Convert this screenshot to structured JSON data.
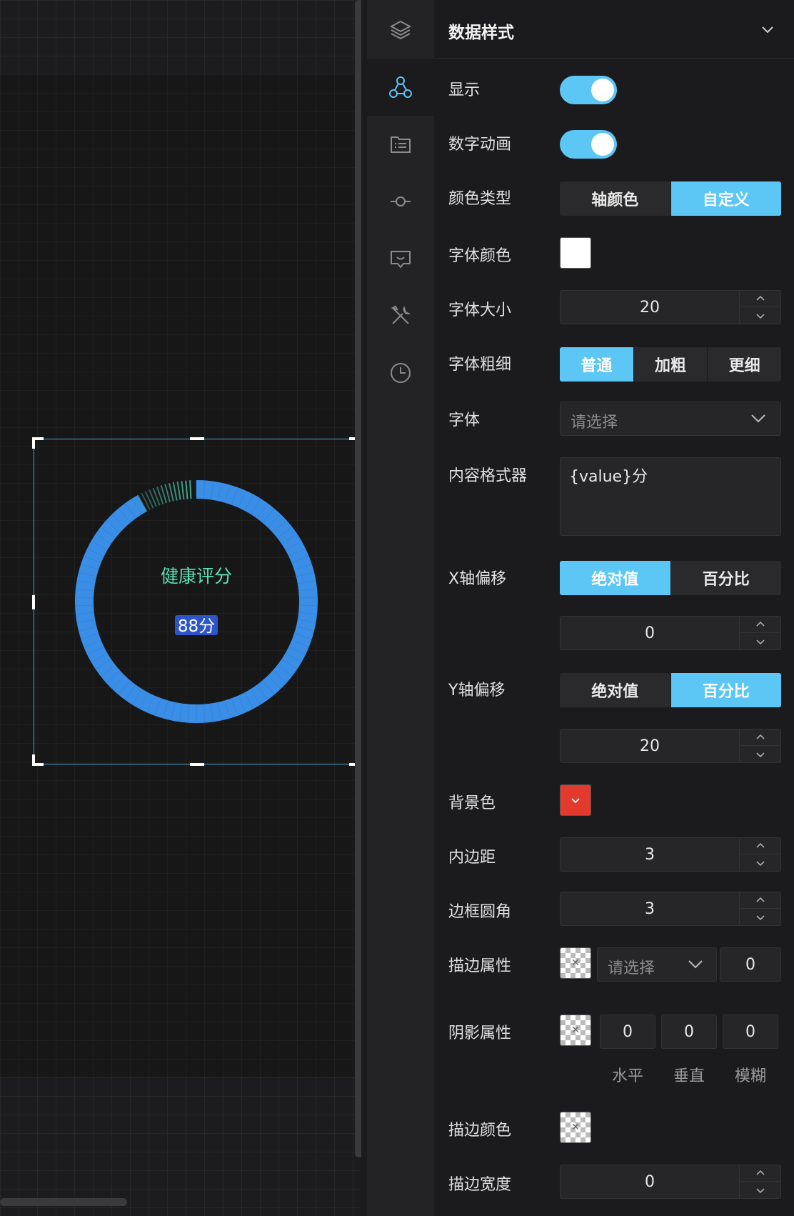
{
  "canvas": {
    "widget_title": "健康评分",
    "widget_value": "88分",
    "gauge_progress": 0.92,
    "colors": {
      "ring": "#3a8ee6",
      "ring_tail": "#4ec2a8",
      "title": "#5fe0b0",
      "value_bg": "#2b55c8"
    }
  },
  "sidebar": {
    "items": [
      {
        "icon": "layers-icon",
        "active": false
      },
      {
        "icon": "data-nodes-icon",
        "active": true
      },
      {
        "icon": "list-icon",
        "active": false
      },
      {
        "icon": "axis-icon",
        "active": false
      },
      {
        "icon": "tooltip-icon",
        "active": false
      },
      {
        "icon": "tools-icon",
        "active": false
      },
      {
        "icon": "clock-icon",
        "active": false
      }
    ]
  },
  "panel": {
    "title": "数据样式",
    "show": {
      "label": "显示",
      "on": true
    },
    "number_animation": {
      "label": "数字动画",
      "on": true
    },
    "color_type": {
      "label": "颜色类型",
      "options": [
        "轴颜色",
        "自定义"
      ],
      "selected": "自定义"
    },
    "font_color": {
      "label": "字体颜色",
      "value": "#ffffff"
    },
    "font_size": {
      "label": "字体大小",
      "value": "20"
    },
    "font_weight": {
      "label": "字体粗细",
      "options": [
        "普通",
        "加粗",
        "更细"
      ],
      "selected": "普通"
    },
    "font_family": {
      "label": "字体",
      "placeholder": "请选择"
    },
    "formatter": {
      "label": "内容格式器",
      "value": "{value}分"
    },
    "x_offset": {
      "label": "X轴偏移",
      "options": [
        "绝对值",
        "百分比"
      ],
      "selected": "绝对值",
      "value": "0"
    },
    "y_offset": {
      "label": "Y轴偏移",
      "options": [
        "绝对值",
        "百分比"
      ],
      "selected": "百分比",
      "value": "20"
    },
    "background_color": {
      "label": "背景色",
      "value": "#e23a2c"
    },
    "padding": {
      "label": "内边距",
      "value": "3"
    },
    "border_radius": {
      "label": "边框圆角",
      "value": "3"
    },
    "stroke": {
      "label": "描边属性",
      "placeholder": "请选择",
      "value": "0"
    },
    "shadow": {
      "label": "阴影属性",
      "horizontal": "0",
      "vertical": "0",
      "blur": "0",
      "captions": [
        "水平",
        "垂直",
        "模糊"
      ]
    },
    "stroke_color": {
      "label": "描边颜色"
    },
    "stroke_width": {
      "label": "描边宽度",
      "value": "0"
    }
  }
}
